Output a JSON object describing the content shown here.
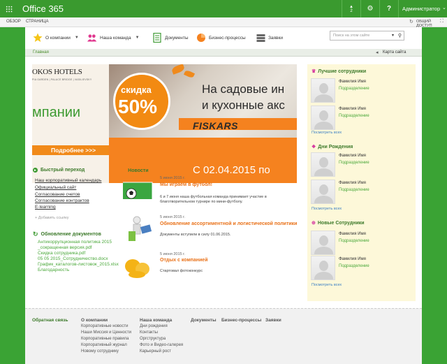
{
  "topbar": {
    "brand": "Office 365",
    "notif_count": "2",
    "user": "Администратор"
  },
  "ribbon": {
    "tabs": [
      "ОБЗОР",
      "СТРАНИЦА"
    ],
    "share": "ОБЩИЙ ДОСТУП"
  },
  "nav": {
    "items": [
      "О компании",
      "Наша команда",
      "Документы",
      "Бизнес-процессы",
      "Заявки"
    ],
    "search_placeholder": "Поиск на этом сайте"
  },
  "breadcrumb": "Главная",
  "sitemap": "Карта сайта",
  "banner_left": {
    "hotel": "OKOS HOTELS",
    "hotel_sub": "PIA GARDEN | PALACE BRIDGE | VASILIEVSKY",
    "campaign": "мпании",
    "more": "Подробнее >>>"
  },
  "banner_main": {
    "discount_word": "скидка",
    "discount_pct": "50%",
    "line1": "На садовые ин",
    "line2": "и кухонные акс",
    "brand": "FISKARS",
    "date": "С 02.04.2015 по"
  },
  "quick": {
    "title": "Быстрый переход",
    "links": [
      "Наш корпоративный календарь",
      "Официальный сайт",
      "Согласование счетов",
      "Согласование контрактов",
      "E-learning"
    ],
    "add_link": "+ Добавить ссылку"
  },
  "docs": {
    "title": "Обновление документов",
    "links": [
      "Антикоррупционная политика 2015",
      "_сокращенная версия.pdf",
      "Скидка сотрудника.pdf",
      "05 05 2015_Сотрудничество.docx",
      "График_каталогов-листовок_2015.xlsx",
      "Благодарность"
    ]
  },
  "news": {
    "title": "Новости",
    "items": [
      {
        "date": "5 июня 2015 г.",
        "title": "Мы играем в футбол!",
        "body": "6 и 7 июня наша футбольная команда принимает участие в благотворительном турнире по мини-футболу."
      },
      {
        "date": "5 июня 2015 г.",
        "title": "Обновление ассортиментной и логистической политики",
        "body": "Документы вступили в силу 01.06.2015."
      },
      {
        "date": "5 июня 2015 г.",
        "title": "Отдых с компанией",
        "body": "Стартовал фотоконкурс"
      }
    ]
  },
  "right": {
    "best": {
      "title": "Лучшие сотрудники",
      "employees": [
        {
          "name": "Фамилия Имя",
          "dept": "Подразделение"
        },
        {
          "name": "Фамилия Имя",
          "dept": "Подразделение"
        }
      ],
      "see_all": "Посмотреть всех"
    },
    "birthdays": {
      "title": "Дни Рождения",
      "employees": [
        {
          "name": "Фамилия Имя",
          "dept": "Подразделение"
        },
        {
          "name": "Фамилия Имя",
          "dept": "Подразделение"
        }
      ],
      "see_all": "Посмотреть всех"
    },
    "new": {
      "title": "Новые Сотрудники",
      "employees": [
        {
          "name": "Фамилия Имя",
          "dept": "Подразделение"
        },
        {
          "name": "Фамилия Имя",
          "dept": "Подразделение"
        }
      ],
      "see_all": "Посмотреть всех"
    }
  },
  "footer": {
    "feedback": "Обратная связь",
    "col1": {
      "title": "О компании",
      "links": [
        "Корпоративные новости",
        "Наши Миссия и Ценности",
        "Корпоративные правила",
        "Корпоративный журнал",
        "Новому сотруднику"
      ]
    },
    "col2": {
      "title": "Наша команда",
      "links": [
        "Дни рождения",
        "Контакты",
        "Оргструктура",
        "Фото и Видео-галерея",
        "Карьерный рост"
      ]
    },
    "col3": {
      "title": "Документы"
    },
    "col4": {
      "title": "Бизнес-процессы"
    },
    "col5": {
      "title": "Заявки"
    }
  },
  "colors": {
    "brand_green": "#3a9a2f",
    "accent_orange": "#f5821f",
    "link_green": "#4aa83a"
  }
}
